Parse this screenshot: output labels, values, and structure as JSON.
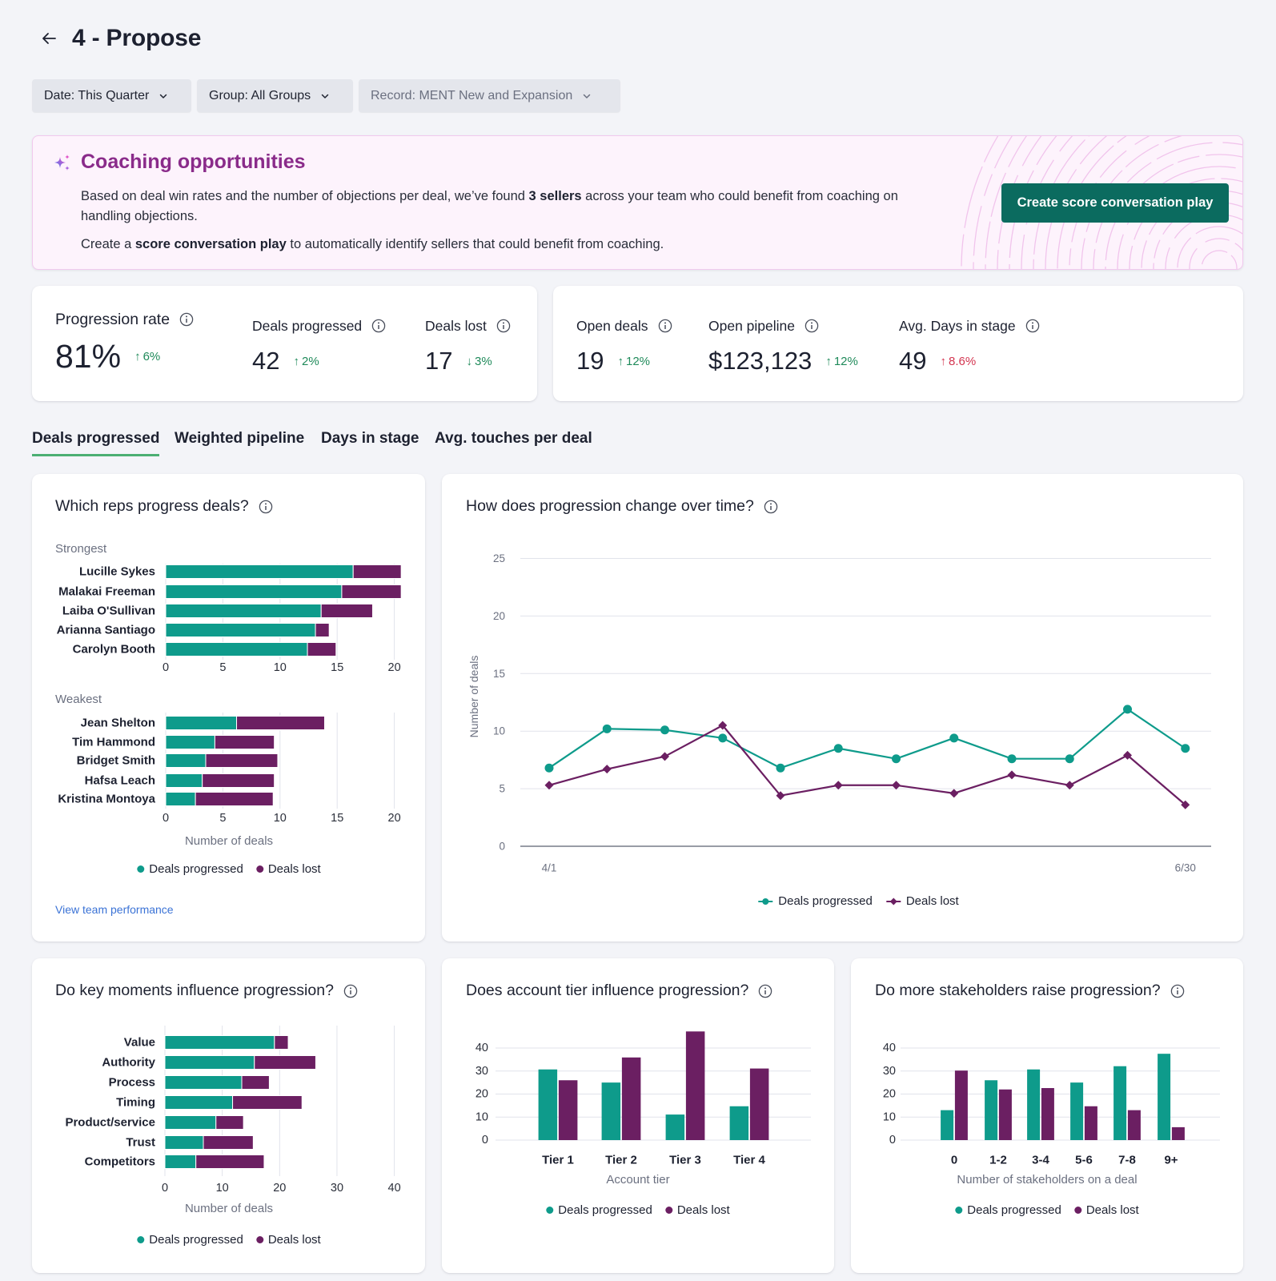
{
  "header": {
    "back_icon": "arrow-left-icon",
    "title": "4 - Propose"
  },
  "filters": [
    {
      "label": "Date: This Quarter",
      "icon": "chevron-down-icon"
    },
    {
      "label": "Group: All Groups",
      "icon": "chevron-down-icon"
    },
    {
      "label": "Record: MENT New and Expansion",
      "icon": "chevron-down-icon",
      "muted": true
    }
  ],
  "coaching": {
    "icon": "sparkle-icon",
    "title": "Coaching opportunities",
    "p1_pre": "Based on deal win rates and the number of objections per deal, we’ve found ",
    "p1_bold": "3 sellers",
    "p1_post": " across your team who could benefit from coaching on handling objections.",
    "p2_pre": "Create a ",
    "p2_bold": "score conversation play",
    "p2_post": " to automatically identify sellers that could benefit from coaching.",
    "button": "Create score conversation play"
  },
  "stats": {
    "group1": [
      {
        "label": "Progression rate",
        "value": "81%",
        "arrow": "↑",
        "delta": "6%",
        "tone": "positive"
      },
      {
        "label": "Deals progressed",
        "value": "42",
        "arrow": "↑",
        "delta": "2%",
        "tone": "positive"
      },
      {
        "label": "Deals lost",
        "value": "17",
        "arrow": "↓",
        "delta": "3%",
        "tone": "positive"
      }
    ],
    "group2": [
      {
        "label": "Open deals",
        "value": "19",
        "arrow": "↑",
        "delta": "12%",
        "tone": "positive"
      },
      {
        "label": "Open pipeline",
        "value": "$123,123",
        "arrow": "↑",
        "delta": "12%",
        "tone": "positive"
      },
      {
        "label": "Avg. Days in stage",
        "value": "49",
        "arrow": "↑",
        "delta": "8.6%",
        "tone": "negative"
      }
    ]
  },
  "tabs": [
    {
      "label": "Deals progressed",
      "active": true
    },
    {
      "label": "Weighted pipeline",
      "active": false
    },
    {
      "label": "Days in stage",
      "active": false
    },
    {
      "label": "Avg. touches per deal",
      "active": false
    }
  ],
  "colors": {
    "progressed": "#0e9b8b",
    "lost": "#6b1f62",
    "positive": "#1f8a5a",
    "negative": "#d3344f",
    "accent": "#0b6b5f",
    "coaching_title": "#8a2b8a",
    "link": "#3b73d6",
    "tab_underline": "#4caf73"
  },
  "cards": {
    "reps": {
      "title": "Which reps progress deals?",
      "link": "View team performance"
    },
    "trend": {
      "title": "How does progression change over time?"
    },
    "moments": {
      "title": "Do key moments influence progression?"
    },
    "tier": {
      "title": "Does account tier influence progression?"
    },
    "stakeholders": {
      "title": "Do more stakeholders raise progression?"
    }
  },
  "chart_data": [
    {
      "type": "bar",
      "orientation": "horizontal",
      "stacked": true,
      "title": "Which reps progress deals?",
      "groups": [
        {
          "label": "Strongest",
          "categories": [
            "Lucille Sykes",
            "Malakai Freeman",
            "Laiba O'Sullivan",
            "Arianna Santiago",
            "Carolyn Booth"
          ],
          "series": [
            {
              "name": "Deals progressed",
              "values": [
                16.4,
                15.4,
                13.6,
                13.1,
                12.4
              ]
            },
            {
              "name": "Deals lost",
              "values": [
                4.2,
                5.2,
                4.5,
                1.2,
                2.5
              ]
            }
          ]
        },
        {
          "label": "Weakest",
          "categories": [
            "Jean Shelton",
            "Tim Hammond",
            "Bridget Smith",
            "Hafsa Leach",
            "Kristina Montoya"
          ],
          "series": [
            {
              "name": "Deals progressed",
              "values": [
                6.2,
                4.3,
                3.5,
                3.2,
                2.6
              ]
            },
            {
              "name": "Deals lost",
              "values": [
                7.7,
                5.2,
                6.3,
                6.3,
                6.8
              ]
            }
          ]
        }
      ],
      "xlabel": "Number of deals",
      "xlim": [
        0,
        20
      ],
      "xticks": [
        "0",
        "5",
        "10",
        "15",
        "20"
      ],
      "xtick_values": [
        0,
        5,
        10,
        15,
        20
      ],
      "grid": true,
      "legend": [
        "Deals progressed",
        "Deals lost"
      ],
      "legend_position": "bottom"
    },
    {
      "type": "line",
      "title": "How does progression change over time?",
      "x_count": 12,
      "x_tick_labels": [
        {
          "index": 0,
          "label": "4/1"
        },
        {
          "index": 11,
          "label": "6/30"
        }
      ],
      "series": [
        {
          "name": "Deals progressed",
          "marker": "circle",
          "values": [
            6.8,
            10.2,
            10.1,
            9.4,
            6.8,
            8.5,
            7.6,
            9.4,
            7.6,
            7.6,
            11.9,
            8.5
          ]
        },
        {
          "name": "Deals lost",
          "marker": "diamond",
          "values": [
            5.3,
            6.7,
            7.8,
            10.5,
            4.4,
            5.3,
            5.3,
            4.6,
            6.2,
            5.3,
            7.9,
            3.6
          ]
        }
      ],
      "ylabel": "Number of deals",
      "ylim": [
        0,
        25
      ],
      "yticks": [
        "0",
        "5",
        "10",
        "15",
        "20",
        "25"
      ],
      "ytick_values": [
        0,
        5,
        10,
        15,
        20,
        25
      ],
      "grid": true,
      "legend": [
        "Deals progressed",
        "Deals lost"
      ],
      "legend_position": "bottom"
    },
    {
      "type": "bar",
      "orientation": "horizontal",
      "stacked": true,
      "title": "Do key moments influence progression?",
      "categories": [
        "Value",
        "Authority",
        "Process",
        "Timing",
        "Product/service",
        "Trust",
        "Competitors"
      ],
      "series": [
        {
          "name": "Deals progressed",
          "values": [
            19.1,
            15.6,
            13.4,
            11.8,
            8.9,
            6.7,
            5.4
          ]
        },
        {
          "name": "Deals lost",
          "values": [
            2.4,
            10.7,
            4.8,
            12.1,
            4.8,
            8.7,
            11.9
          ]
        }
      ],
      "xlabel": "Number of deals",
      "xlim": [
        0,
        40
      ],
      "xticks": [
        "0",
        "10",
        "20",
        "30",
        "40"
      ],
      "xtick_values": [
        0,
        10,
        20,
        30,
        40
      ],
      "grid": true,
      "legend": [
        "Deals progressed",
        "Deals lost"
      ],
      "legend_position": "bottom"
    },
    {
      "type": "bar",
      "orientation": "vertical",
      "stacked": false,
      "title": "Does account tier influence progression?",
      "categories": [
        "Tier 1",
        "Tier 2",
        "Tier 3",
        "Tier 4"
      ],
      "series": [
        {
          "name": "Deals progressed",
          "values": [
            30.7,
            25.0,
            11.1,
            14.7
          ]
        },
        {
          "name": "Deals lost",
          "values": [
            26.0,
            35.9,
            47.2,
            31.1
          ]
        }
      ],
      "xlabel": "Account tier",
      "ylim": [
        0,
        40
      ],
      "yticks": [
        "0",
        "10",
        "20",
        "30",
        "40"
      ],
      "ytick_values": [
        0,
        10,
        20,
        30,
        40
      ],
      "grid": true,
      "legend": [
        "Deals progressed",
        "Deals lost"
      ],
      "legend_position": "bottom"
    },
    {
      "type": "bar",
      "orientation": "vertical",
      "stacked": false,
      "title": "Do more stakeholders raise progression?",
      "categories": [
        "0",
        "1-2",
        "3-4",
        "5-6",
        "7-8",
        "9+"
      ],
      "series": [
        {
          "name": "Deals progressed",
          "values": [
            13.0,
            26.0,
            30.7,
            25.0,
            32.1,
            37.5
          ]
        },
        {
          "name": "Deals lost",
          "values": [
            30.2,
            22.0,
            22.6,
            14.7,
            13.0,
            5.6
          ]
        }
      ],
      "xlabel": "Number of stakeholders on a deal",
      "ylim": [
        0,
        40
      ],
      "yticks": [
        "0",
        "10",
        "20",
        "30",
        "40"
      ],
      "ytick_values": [
        0,
        10,
        20,
        30,
        40
      ],
      "grid": true,
      "legend": [
        "Deals progressed",
        "Deals lost"
      ],
      "legend_position": "bottom"
    }
  ]
}
